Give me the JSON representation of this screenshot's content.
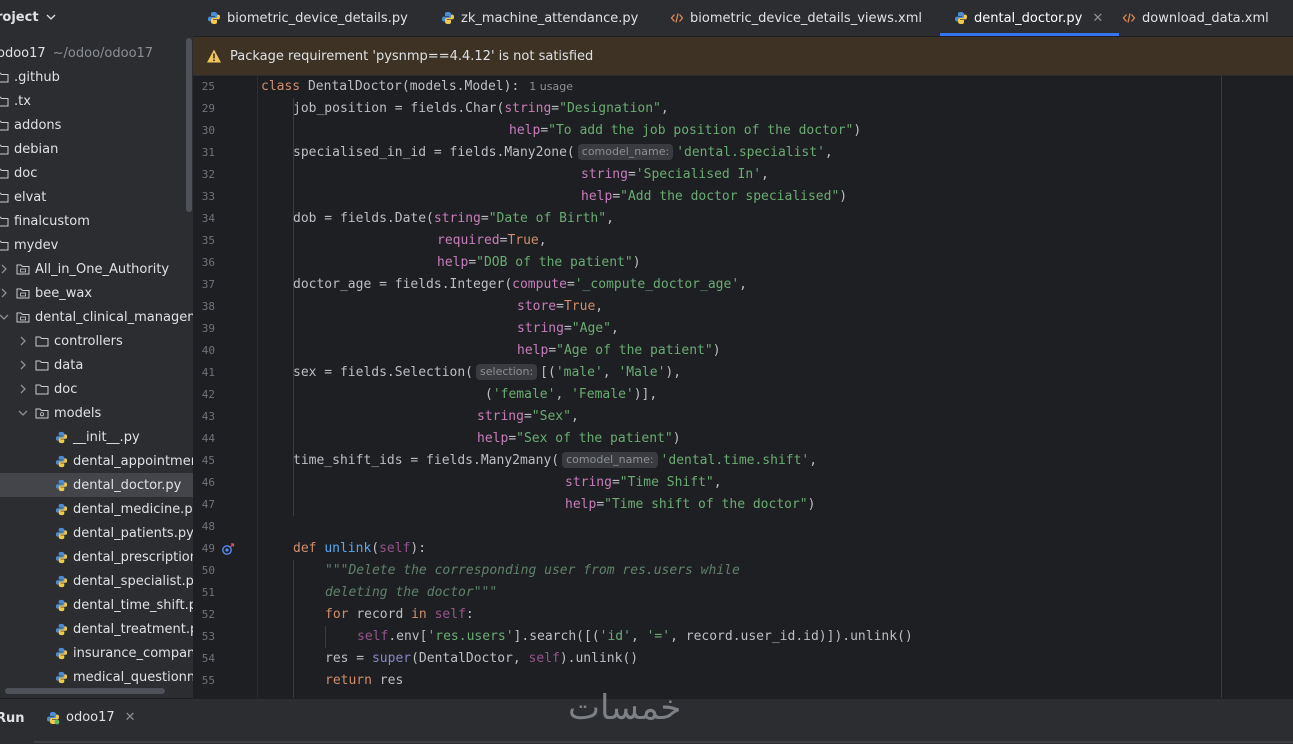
{
  "project": {
    "title": "roject",
    "tree": [
      {
        "label": "odoo17",
        "sub": "~/odoo/odoo17",
        "level": "root"
      },
      {
        "label": ".github"
      },
      {
        "label": ".tx"
      },
      {
        "label": "addons"
      },
      {
        "label": "debian"
      },
      {
        "label": "doc"
      },
      {
        "label": "elvat"
      },
      {
        "label": "finalcustom"
      },
      {
        "label": "mydev"
      },
      {
        "label": "All_in_One_Authority"
      },
      {
        "label": "bee_wax"
      },
      {
        "label": "dental_clinical_management"
      },
      {
        "label": "controllers"
      },
      {
        "label": "data"
      },
      {
        "label": "doc"
      },
      {
        "label": "models"
      },
      {
        "label": "__init__.py"
      },
      {
        "label": "dental_appointment.py"
      },
      {
        "label": "dental_doctor.py"
      },
      {
        "label": "dental_medicine.py"
      },
      {
        "label": "dental_patients.py"
      },
      {
        "label": "dental_prescription.py"
      },
      {
        "label": "dental_specialist.py"
      },
      {
        "label": "dental_time_shift.py"
      },
      {
        "label": "dental_treatment.py"
      },
      {
        "label": "insurance_company.py"
      },
      {
        "label": "medical_questionnaire.py"
      }
    ]
  },
  "tabs": [
    {
      "label": "biometric_device_details.py",
      "icon": "python-icon"
    },
    {
      "label": "zk_machine_attendance.py",
      "icon": "python-icon"
    },
    {
      "label": "biometric_device_details_views.xml",
      "icon": "xml-icon"
    },
    {
      "label": "dental_doctor.py",
      "icon": "python-icon",
      "active": true
    },
    {
      "label": "download_data.xml",
      "icon": "xml-icon"
    }
  ],
  "banner": {
    "text": "Package requirement 'pysnmp==4.4.12' is not satisfied"
  },
  "editor": {
    "usage": "1 usage",
    "hints": {
      "comodel": "comodel_name:",
      "selection": "selection:"
    },
    "line_numbers": [
      "25",
      "29",
      "30",
      "31",
      "32",
      "33",
      "34",
      "35",
      "36",
      "37",
      "38",
      "39",
      "40",
      "41",
      "42",
      "43",
      "44",
      "45",
      "46",
      "47",
      "48",
      "49",
      "50",
      "51",
      "52",
      "53",
      "54",
      "55"
    ]
  },
  "bottom": {
    "run_label": "Run",
    "run_tab": "odoo17",
    "watermark": "خمسات"
  }
}
